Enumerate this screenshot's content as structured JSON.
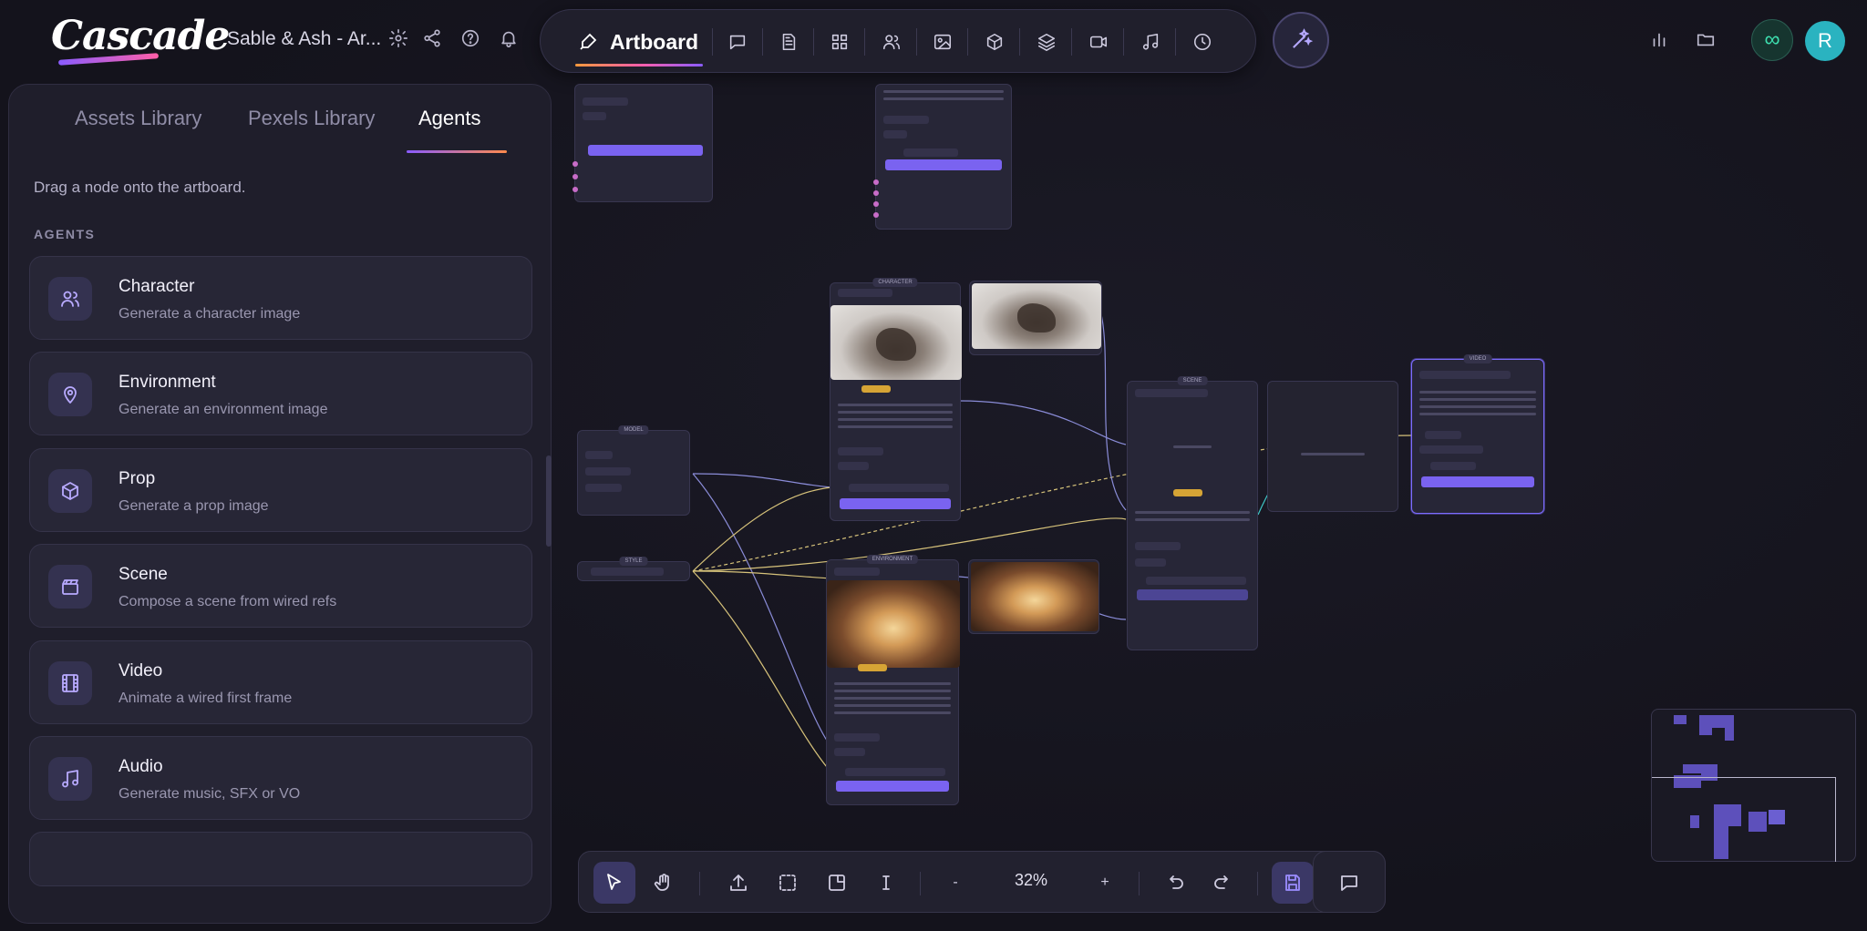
{
  "app": {
    "logo_text": "Cascade",
    "project_title": "Sable & Ash - Ar..."
  },
  "toolbar": {
    "artboard_label": "Artboard",
    "icons": [
      "chat-icon",
      "document-icon",
      "grid-icon",
      "users-icon",
      "image-icon",
      "cube-icon",
      "layers-icon",
      "video-icon",
      "music-icon",
      "history-icon"
    ]
  },
  "panel": {
    "tabs": [
      "Assets Library",
      "Pexels Library",
      "Agents"
    ],
    "active_tab": "Agents",
    "hint": "Drag a node onto the artboard.",
    "section_label": "AGENTS",
    "agents": [
      {
        "name": "Character",
        "desc": "Generate a character image",
        "icon": "users-icon"
      },
      {
        "name": "Environment",
        "desc": "Generate an environment image",
        "icon": "map-pin-icon"
      },
      {
        "name": "Prop",
        "desc": "Generate a prop image",
        "icon": "cube-icon"
      },
      {
        "name": "Scene",
        "desc": "Compose a scene from wired refs",
        "icon": "clapperboard-icon"
      },
      {
        "name": "Video",
        "desc": "Animate a wired first frame",
        "icon": "film-icon"
      },
      {
        "name": "Audio",
        "desc": "Generate music, SFX or VO",
        "icon": "music-icon"
      }
    ]
  },
  "user": {
    "avatar_initial": "R",
    "infinity_symbol": "∞"
  },
  "bottom_toolbar": {
    "zoom": "32%",
    "zoom_out": "-",
    "zoom_in": "+"
  },
  "colors": {
    "accent": "#7a63f0",
    "background": "#14131c",
    "panel": "#1f1e2b",
    "avatar": "#2ab3c0",
    "infinity": "#3ee0b0"
  }
}
